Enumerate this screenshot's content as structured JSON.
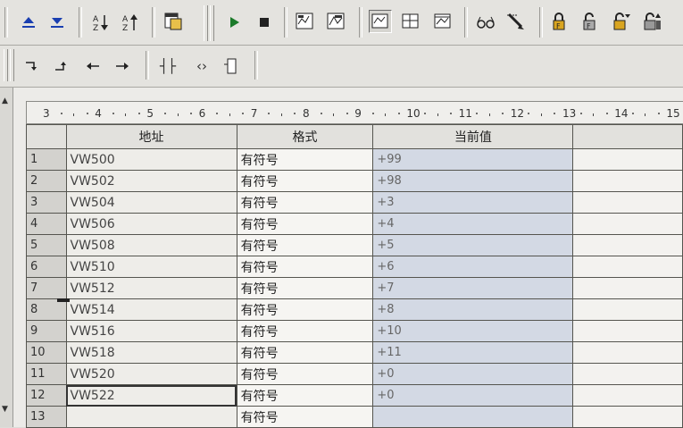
{
  "toolbar1": {
    "icons": [
      "move-up-icon",
      "move-down-icon",
      "sort-ascending-icon",
      "sort-descending-icon",
      "copy-table-icon",
      "run-icon",
      "stop-icon",
      "status-chart-icon",
      "trend-icon",
      "table-view-1-icon",
      "table-view-2-icon",
      "table-view-3-icon",
      "glasses-icon",
      "write-pen-icon",
      "lock-icon",
      "unlock-icon",
      "unlock-all-icon",
      "read-all-icon"
    ]
  },
  "toolbar2": {
    "icons": [
      "insert-contact-icon",
      "insert-down-icon",
      "arrow-left-icon",
      "arrow-right-icon",
      "contact-icon",
      "coil-icon",
      "box-icon"
    ],
    "contact_label": "┤├",
    "coil_label": "‹›"
  },
  "ruler": {
    "ticks": [
      "3",
      "4",
      "5",
      "6",
      "7",
      "8",
      "9",
      "10",
      "11",
      "12",
      "13",
      "14",
      "15"
    ]
  },
  "table": {
    "headers": {
      "address": "地址",
      "format": "格式",
      "current_value": "当前值"
    },
    "rows": [
      {
        "num": "1",
        "address": "VW500",
        "format": "有符号",
        "value": "+99"
      },
      {
        "num": "2",
        "address": "VW502",
        "format": "有符号",
        "value": "+98"
      },
      {
        "num": "3",
        "address": "VW504",
        "format": "有符号",
        "value": "+3"
      },
      {
        "num": "4",
        "address": "VW506",
        "format": "有符号",
        "value": "+4"
      },
      {
        "num": "5",
        "address": "VW508",
        "format": "有符号",
        "value": "+5"
      },
      {
        "num": "6",
        "address": "VW510",
        "format": "有符号",
        "value": "+6"
      },
      {
        "num": "7",
        "address": "VW512",
        "format": "有符号",
        "value": "+7"
      },
      {
        "num": "8",
        "address": "VW514",
        "format": "有符号",
        "value": "+8"
      },
      {
        "num": "9",
        "address": "VW516",
        "format": "有符号",
        "value": "+10"
      },
      {
        "num": "10",
        "address": "VW518",
        "format": "有符号",
        "value": "+11"
      },
      {
        "num": "11",
        "address": "VW520",
        "format": "有符号",
        "value": "+0"
      },
      {
        "num": "12",
        "address": "VW522",
        "format": "有符号",
        "value": "+0"
      },
      {
        "num": "13",
        "address": "",
        "format": "有符号",
        "value": ""
      }
    ]
  }
}
